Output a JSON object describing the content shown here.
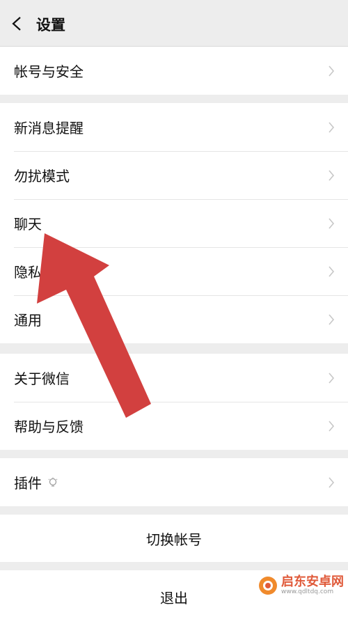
{
  "header": {
    "title": "设置"
  },
  "groups": [
    {
      "items": [
        {
          "label": "帐号与安全"
        }
      ]
    },
    {
      "items": [
        {
          "label": "新消息提醒"
        },
        {
          "label": "勿扰模式"
        },
        {
          "label": "聊天"
        },
        {
          "label": "隐私"
        },
        {
          "label": "通用"
        }
      ]
    },
    {
      "items": [
        {
          "label": "关于微信"
        },
        {
          "label": "帮助与反馈"
        }
      ]
    },
    {
      "items": [
        {
          "label": "插件"
        }
      ]
    }
  ],
  "switch_account": "切换帐号",
  "logout": "退出",
  "annotation": {
    "color": "#d2403f"
  },
  "watermark": {
    "text": "启东安卓网",
    "url": "www.qdltdq.com"
  }
}
